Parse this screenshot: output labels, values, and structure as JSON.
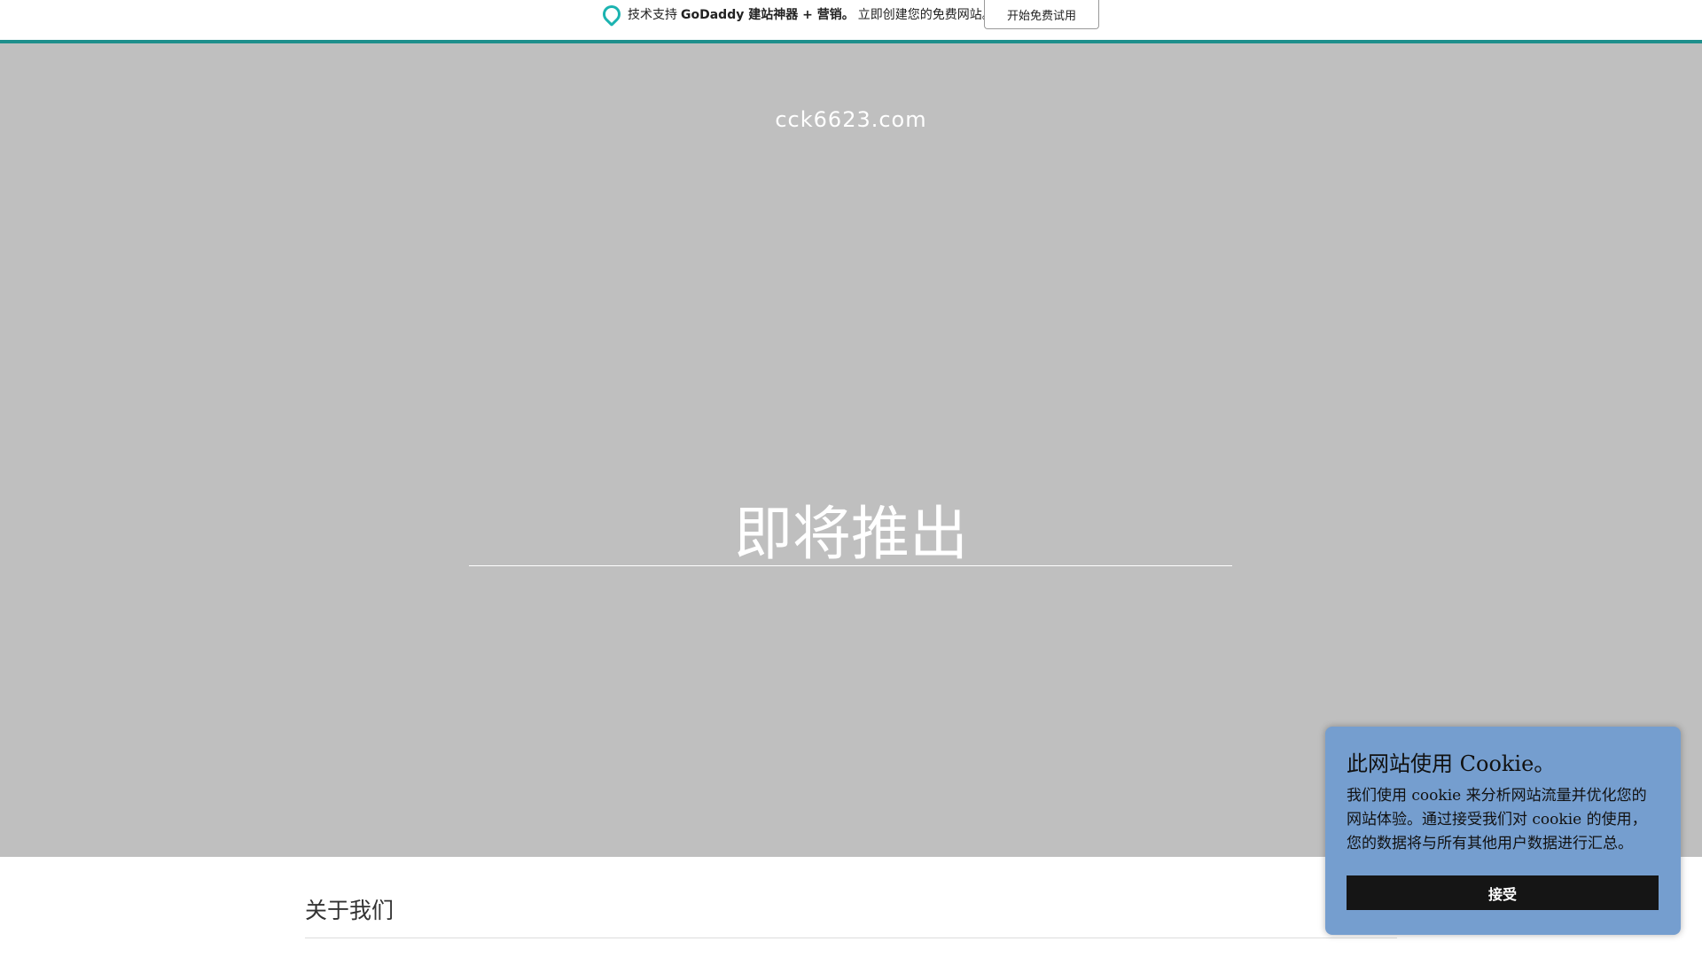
{
  "topbar": {
    "prefix": "技术支持",
    "brand": "GoDaddy 建站神器 + 营销。",
    "suffix": "立即创建您的免费网站。",
    "cta": "开始免费试用"
  },
  "hero": {
    "domain": "cck6623.com",
    "title": "即将推出"
  },
  "about": {
    "heading": "关于我们"
  },
  "cookie": {
    "title": "此网站使用 Cookie。",
    "body": "我们使用 cookie 来分析网站流量并优化您的网站体验。通过接受我们对 cookie 的使用，您的数据将与所有其他用户数据进行汇总。",
    "accept": "接受"
  },
  "colors": {
    "accent": "#1e8f8c",
    "hero_bg": "#bfbfbf",
    "cookie_bg": "#759ecf"
  }
}
